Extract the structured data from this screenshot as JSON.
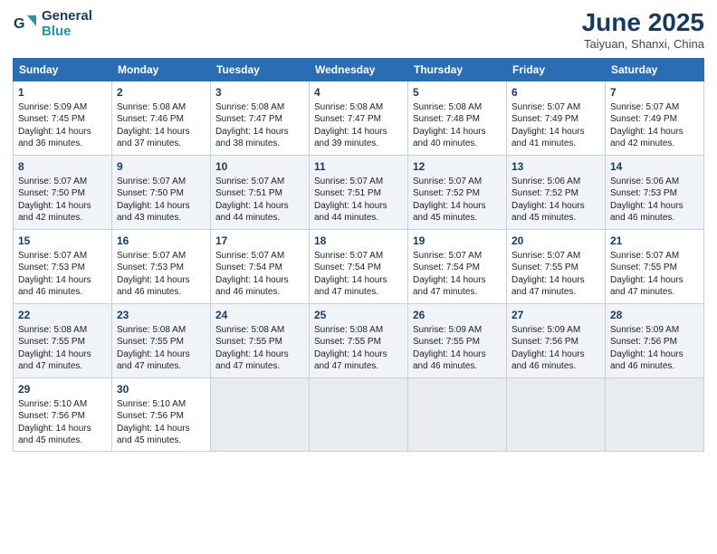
{
  "header": {
    "logo_line1": "General",
    "logo_line2": "Blue",
    "month_title": "June 2025",
    "subtitle": "Taiyuan, Shanxi, China"
  },
  "weekdays": [
    "Sunday",
    "Monday",
    "Tuesday",
    "Wednesday",
    "Thursday",
    "Friday",
    "Saturday"
  ],
  "weeks": [
    [
      {
        "day": "1",
        "lines": [
          "Sunrise: 5:09 AM",
          "Sunset: 7:45 PM",
          "Daylight: 14 hours",
          "and 36 minutes."
        ]
      },
      {
        "day": "2",
        "lines": [
          "Sunrise: 5:08 AM",
          "Sunset: 7:46 PM",
          "Daylight: 14 hours",
          "and 37 minutes."
        ]
      },
      {
        "day": "3",
        "lines": [
          "Sunrise: 5:08 AM",
          "Sunset: 7:47 PM",
          "Daylight: 14 hours",
          "and 38 minutes."
        ]
      },
      {
        "day": "4",
        "lines": [
          "Sunrise: 5:08 AM",
          "Sunset: 7:47 PM",
          "Daylight: 14 hours",
          "and 39 minutes."
        ]
      },
      {
        "day": "5",
        "lines": [
          "Sunrise: 5:08 AM",
          "Sunset: 7:48 PM",
          "Daylight: 14 hours",
          "and 40 minutes."
        ]
      },
      {
        "day": "6",
        "lines": [
          "Sunrise: 5:07 AM",
          "Sunset: 7:49 PM",
          "Daylight: 14 hours",
          "and 41 minutes."
        ]
      },
      {
        "day": "7",
        "lines": [
          "Sunrise: 5:07 AM",
          "Sunset: 7:49 PM",
          "Daylight: 14 hours",
          "and 42 minutes."
        ]
      }
    ],
    [
      {
        "day": "8",
        "lines": [
          "Sunrise: 5:07 AM",
          "Sunset: 7:50 PM",
          "Daylight: 14 hours",
          "and 42 minutes."
        ]
      },
      {
        "day": "9",
        "lines": [
          "Sunrise: 5:07 AM",
          "Sunset: 7:50 PM",
          "Daylight: 14 hours",
          "and 43 minutes."
        ]
      },
      {
        "day": "10",
        "lines": [
          "Sunrise: 5:07 AM",
          "Sunset: 7:51 PM",
          "Daylight: 14 hours",
          "and 44 minutes."
        ]
      },
      {
        "day": "11",
        "lines": [
          "Sunrise: 5:07 AM",
          "Sunset: 7:51 PM",
          "Daylight: 14 hours",
          "and 44 minutes."
        ]
      },
      {
        "day": "12",
        "lines": [
          "Sunrise: 5:07 AM",
          "Sunset: 7:52 PM",
          "Daylight: 14 hours",
          "and 45 minutes."
        ]
      },
      {
        "day": "13",
        "lines": [
          "Sunrise: 5:06 AM",
          "Sunset: 7:52 PM",
          "Daylight: 14 hours",
          "and 45 minutes."
        ]
      },
      {
        "day": "14",
        "lines": [
          "Sunrise: 5:06 AM",
          "Sunset: 7:53 PM",
          "Daylight: 14 hours",
          "and 46 minutes."
        ]
      }
    ],
    [
      {
        "day": "15",
        "lines": [
          "Sunrise: 5:07 AM",
          "Sunset: 7:53 PM",
          "Daylight: 14 hours",
          "and 46 minutes."
        ]
      },
      {
        "day": "16",
        "lines": [
          "Sunrise: 5:07 AM",
          "Sunset: 7:53 PM",
          "Daylight: 14 hours",
          "and 46 minutes."
        ]
      },
      {
        "day": "17",
        "lines": [
          "Sunrise: 5:07 AM",
          "Sunset: 7:54 PM",
          "Daylight: 14 hours",
          "and 46 minutes."
        ]
      },
      {
        "day": "18",
        "lines": [
          "Sunrise: 5:07 AM",
          "Sunset: 7:54 PM",
          "Daylight: 14 hours",
          "and 47 minutes."
        ]
      },
      {
        "day": "19",
        "lines": [
          "Sunrise: 5:07 AM",
          "Sunset: 7:54 PM",
          "Daylight: 14 hours",
          "and 47 minutes."
        ]
      },
      {
        "day": "20",
        "lines": [
          "Sunrise: 5:07 AM",
          "Sunset: 7:55 PM",
          "Daylight: 14 hours",
          "and 47 minutes."
        ]
      },
      {
        "day": "21",
        "lines": [
          "Sunrise: 5:07 AM",
          "Sunset: 7:55 PM",
          "Daylight: 14 hours",
          "and 47 minutes."
        ]
      }
    ],
    [
      {
        "day": "22",
        "lines": [
          "Sunrise: 5:08 AM",
          "Sunset: 7:55 PM",
          "Daylight: 14 hours",
          "and 47 minutes."
        ]
      },
      {
        "day": "23",
        "lines": [
          "Sunrise: 5:08 AM",
          "Sunset: 7:55 PM",
          "Daylight: 14 hours",
          "and 47 minutes."
        ]
      },
      {
        "day": "24",
        "lines": [
          "Sunrise: 5:08 AM",
          "Sunset: 7:55 PM",
          "Daylight: 14 hours",
          "and 47 minutes."
        ]
      },
      {
        "day": "25",
        "lines": [
          "Sunrise: 5:08 AM",
          "Sunset: 7:55 PM",
          "Daylight: 14 hours",
          "and 47 minutes."
        ]
      },
      {
        "day": "26",
        "lines": [
          "Sunrise: 5:09 AM",
          "Sunset: 7:55 PM",
          "Daylight: 14 hours",
          "and 46 minutes."
        ]
      },
      {
        "day": "27",
        "lines": [
          "Sunrise: 5:09 AM",
          "Sunset: 7:56 PM",
          "Daylight: 14 hours",
          "and 46 minutes."
        ]
      },
      {
        "day": "28",
        "lines": [
          "Sunrise: 5:09 AM",
          "Sunset: 7:56 PM",
          "Daylight: 14 hours",
          "and 46 minutes."
        ]
      }
    ],
    [
      {
        "day": "29",
        "lines": [
          "Sunrise: 5:10 AM",
          "Sunset: 7:56 PM",
          "Daylight: 14 hours",
          "and 45 minutes."
        ]
      },
      {
        "day": "30",
        "lines": [
          "Sunrise: 5:10 AM",
          "Sunset: 7:56 PM",
          "Daylight: 14 hours",
          "and 45 minutes."
        ]
      },
      {
        "day": "",
        "lines": []
      },
      {
        "day": "",
        "lines": []
      },
      {
        "day": "",
        "lines": []
      },
      {
        "day": "",
        "lines": []
      },
      {
        "day": "",
        "lines": []
      }
    ]
  ]
}
